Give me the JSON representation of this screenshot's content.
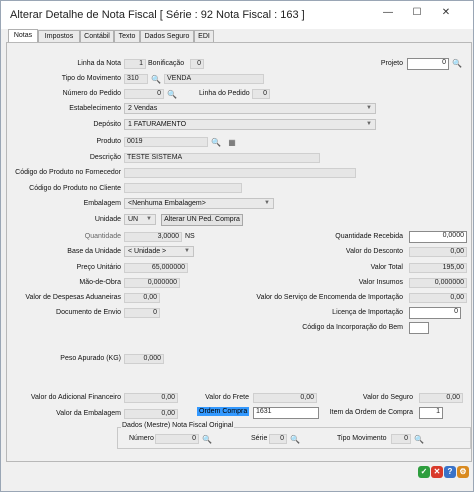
{
  "window": {
    "title": "Alterar Detalhe de Nota Fiscal [ Série : 92 Nota Fiscal : 163 ]",
    "minimize": "—",
    "maximize": "☐",
    "close": "✕"
  },
  "tabs": [
    "Notas",
    "Impostos",
    "Contábil",
    "Texto",
    "Dados Seguro",
    "EDI"
  ],
  "form": {
    "linha_nota_label": "Linha da Nota",
    "linha_nota": "1",
    "bonificacao_label": "Bonificação",
    "bonificacao": "0",
    "projeto_label": "Projeto",
    "projeto": "0",
    "tipo_mov_label": "Tipo do Movimento",
    "tipo_mov_code": "310",
    "tipo_mov_name": "VENDA",
    "num_pedido_label": "Número do Pedido",
    "num_pedido": "0",
    "linha_pedido_label": "Linha do Pedido",
    "linha_pedido": "0",
    "estabelecimento_label": "Estabelecimento",
    "estabelecimento": "2 Vendas",
    "deposito_label": "Depósito",
    "deposito": "1 FATURAMENTO",
    "produto_label": "Produto",
    "produto": "0019",
    "descricao_label": "Descrição",
    "descricao": "TESTE SISTEMA",
    "cod_fornecedor_label": "Código do Produto no Fornecedor",
    "cod_fornecedor": "",
    "cod_cliente_label": "Código do Produto no Cliente",
    "cod_cliente": "",
    "embalagem_label": "Embalagem",
    "embalagem": "<Nenhuma Embalagem>",
    "unidade_label": "Unidade",
    "unidade": "UN",
    "alterar_un_button": "Alterar UN Ped. Compra",
    "quantidade_label": "Quantidade",
    "quantidade": "3,0000",
    "quantidade_unit": "NS",
    "qtd_recebida_label": "Quantidade Recebida",
    "qtd_recebida": "0,0000",
    "base_unidade_label": "Base da Unidade",
    "base_unidade": "< Unidade >",
    "valor_desconto_label": "Valor do Desconto",
    "valor_desconto": "0,00",
    "preco_unitario_label": "Preço Unitário",
    "preco_unitario": "65,000000",
    "valor_total_label": "Valor Total",
    "valor_total": "195,00",
    "mao_obra_label": "Mão-de-Obra",
    "mao_obra": "0,000000",
    "valor_insumos_label": "Valor Insumos",
    "valor_insumos": "0,000000",
    "despesas_aduaneiras_label": "Valor de Despesas Aduaneiras",
    "despesas_aduaneiras": "0,00",
    "servico_importacao_label": "Valor do Serviço de Encomenda de Importação",
    "servico_importacao": "0,00",
    "documento_envio_label": "Documento de Envio",
    "documento_envio": "0",
    "licenca_importacao_label": "Licença de Importação",
    "licenca_importacao": "0",
    "cod_incorporacao_label": "Código da Incorporação do Bem",
    "cod_incorporacao": "",
    "peso_apurado_label": "Peso Apurado (KG)",
    "peso_apurado": "0,000",
    "adicional_financeiro_label": "Valor do Adicional Financeiro",
    "adicional_financeiro": "0,00",
    "valor_frete_label": "Valor do Frete",
    "valor_frete": "0,00",
    "valor_seguro_label": "Valor do Seguro",
    "valor_seguro": "0,00",
    "valor_embalagem_label": "Valor da Embalagem",
    "valor_embalagem": "0,00",
    "ordem_compra_label": "Ordem Compra",
    "ordem_compra": "1631",
    "item_ordem_label": "Item da Ordem de Compra",
    "item_ordem": "1"
  },
  "original": {
    "legend": "Dados (Mestre) Nota Fiscal Original",
    "numero_label": "Número",
    "numero": "0",
    "serie_label": "Série",
    "serie": "0",
    "tipo_mov_label": "Tipo Movimento",
    "tipo_mov": "0"
  },
  "footer": {
    "ok": "✓",
    "cancel": "✕",
    "help": "?",
    "tools": "⚙"
  },
  "colors": {
    "highlight": "#3399ff",
    "ok": "#2e9e3e",
    "cancel": "#d93a2b",
    "help": "#3a73c9",
    "tools": "#d98a1f"
  },
  "icons": {
    "search": "binoculars-icon",
    "grid": "grid-icon",
    "dropdown": "chevron-down-icon"
  }
}
